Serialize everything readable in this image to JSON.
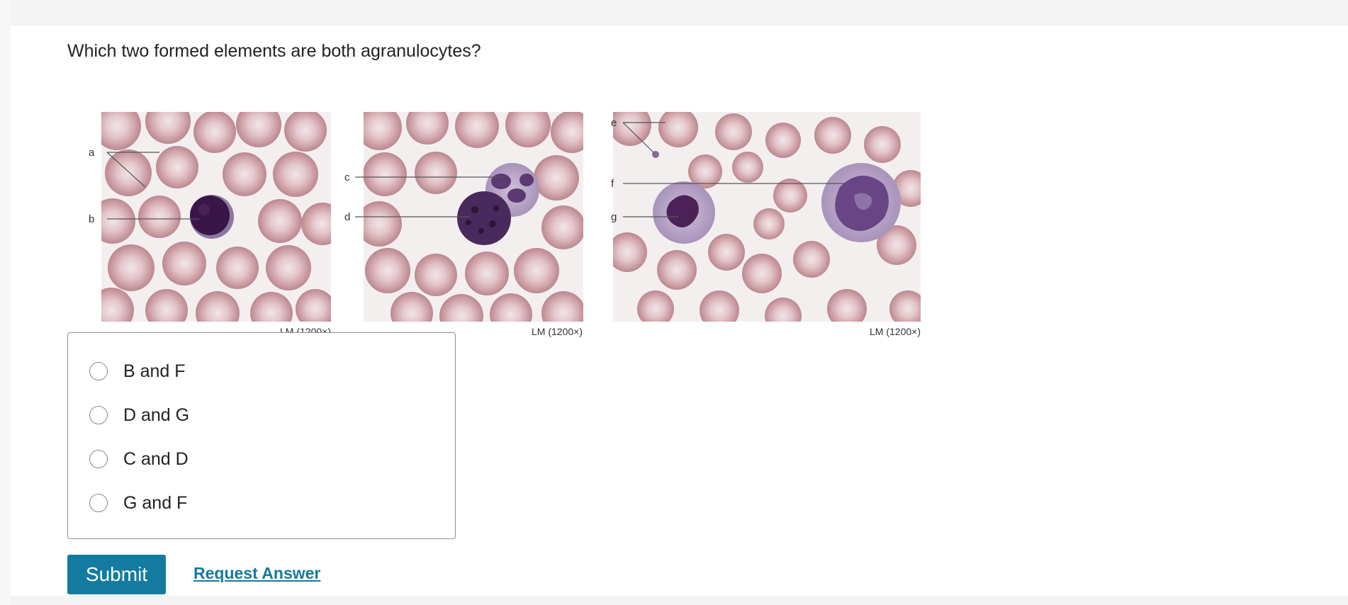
{
  "question": {
    "text": "Which two formed elements are both agranulocytes?"
  },
  "figure": {
    "panels": [
      {
        "labels": [
          "a",
          "b"
        ],
        "magnification": "LM (1200×)"
      },
      {
        "labels": [
          "c",
          "d"
        ],
        "magnification": "LM (1200×)"
      },
      {
        "labels": [
          "e",
          "f",
          "g"
        ],
        "magnification": "LM (1200×)"
      }
    ]
  },
  "choices": [
    {
      "label": "B and F",
      "selected": false
    },
    {
      "label": "D and G",
      "selected": false
    },
    {
      "label": "C and D",
      "selected": false
    },
    {
      "label": "G and F",
      "selected": false
    }
  ],
  "actions": {
    "submit_label": "Submit",
    "request_answer_label": "Request Answer"
  },
  "colors": {
    "accent": "#137b9f",
    "rbc": "#c9989f",
    "lymphocyte_nucleus": "#3a1648",
    "granulocyte_nucleus": "#5b3a72"
  }
}
